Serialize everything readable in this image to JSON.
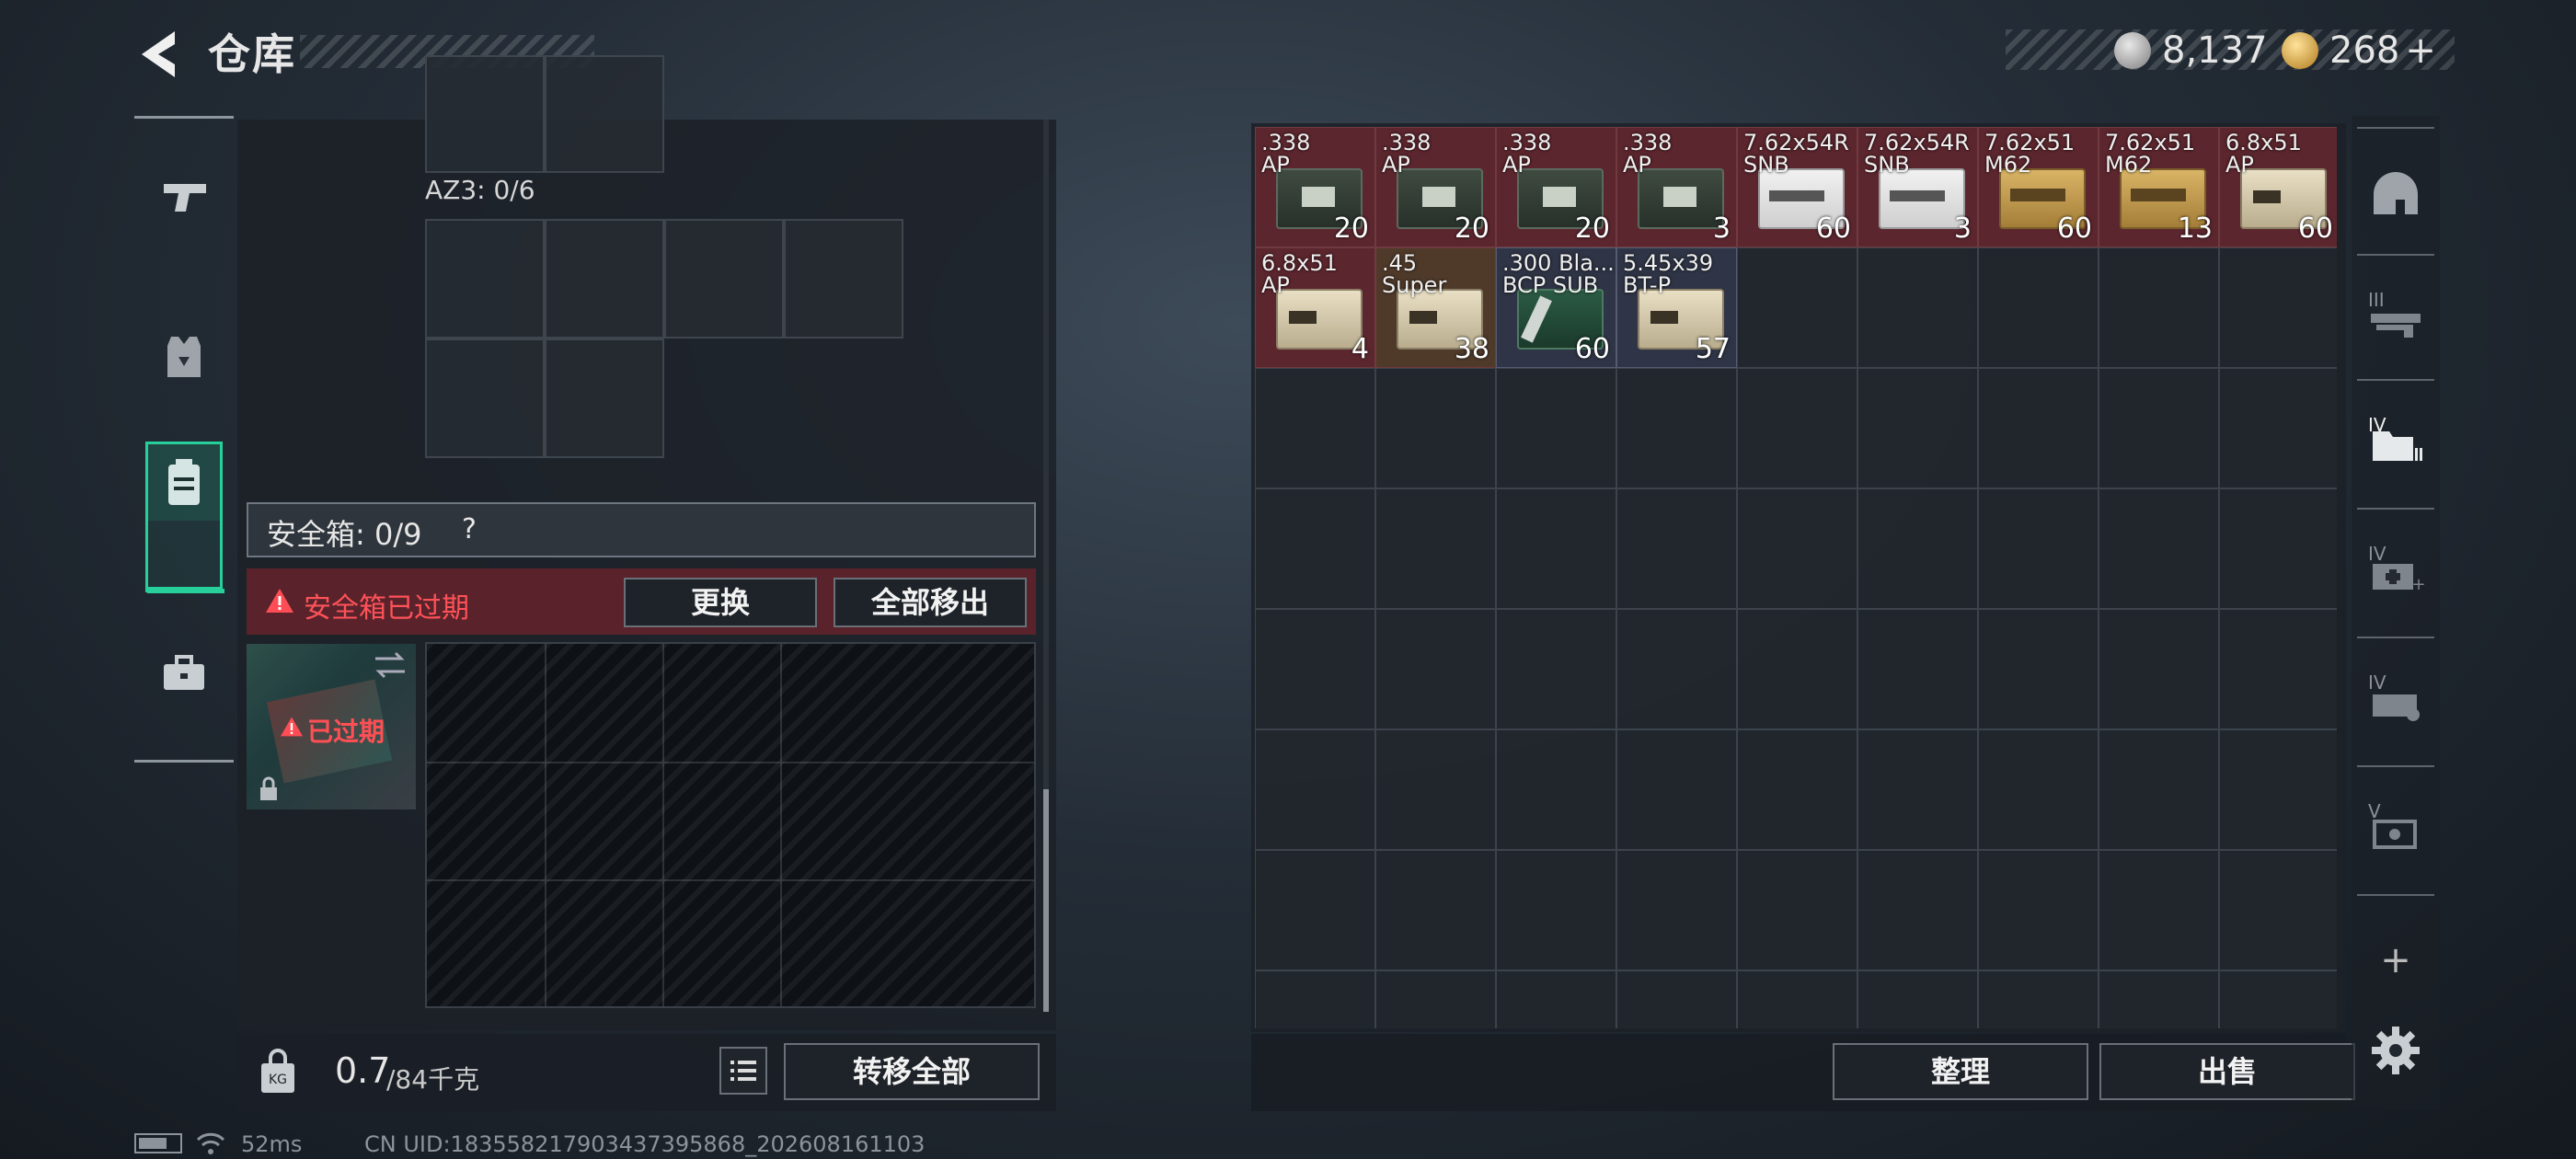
{
  "header": {
    "title": "仓库"
  },
  "currency": [
    {
      "icon": "silver-coin-icon",
      "value": "8,137"
    },
    {
      "icon": "gold-coin-icon",
      "value": "268"
    }
  ],
  "left_tabs": [
    {
      "icon": "pistol-icon"
    },
    {
      "icon": "armor-vest-icon"
    },
    {
      "icon": "backpack-icon",
      "active": true
    },
    {
      "icon": "toolbox-icon"
    }
  ],
  "loadout": {
    "az3_label": "AZ3: 0/6",
    "secure_label": "安全箱: 0/9",
    "help": "?",
    "expired_warning": "安全箱已过期",
    "replace_button": "更换",
    "move_all_out_button": "全部移出",
    "case_status": "已过期"
  },
  "weight": {
    "current": "0.7",
    "max": "/84千克"
  },
  "transfer_all_button": "转移全部",
  "stash": {
    "items": [
      {
        "name": ".338\nAP",
        "count": "20",
        "style": "red",
        "box": "dark"
      },
      {
        "name": ".338\nAP",
        "count": "20",
        "style": "red",
        "box": "dark"
      },
      {
        "name": ".338\nAP",
        "count": "20",
        "style": "red",
        "box": "dark"
      },
      {
        "name": ".338\nAP",
        "count": "3",
        "style": "red",
        "box": "dark"
      },
      {
        "name": "7.62x54R\nSNB",
        "count": "60",
        "style": "red",
        "box": "white"
      },
      {
        "name": "7.62x54R\nSNB",
        "count": "3",
        "style": "red",
        "box": "white"
      },
      {
        "name": "7.62x51\nM62",
        "count": "60",
        "style": "red",
        "box": "gold"
      },
      {
        "name": "7.62x51\nM62",
        "count": "13",
        "style": "red",
        "box": "gold"
      },
      {
        "name": "6.8x51\nAP",
        "count": "60",
        "style": "red",
        "box": "cream"
      },
      {
        "name": "6.8x51\nAP",
        "count": "4",
        "style": "red",
        "box": "cream"
      },
      {
        "name": ".45\nSuper",
        "count": "38",
        "style": "brown",
        "box": "cream"
      },
      {
        "name": ".300 Bla...\nBCP SUB",
        "count": "60",
        "style": "blue",
        "box": "green"
      },
      {
        "name": "5.45x39\nBT-P",
        "count": "57",
        "style": "blue",
        "box": "cream"
      }
    ],
    "sort_button": "整理",
    "sell_button": "出售"
  },
  "right_tabs": [
    {
      "icon": "helmet-icon",
      "label": ""
    },
    {
      "icon": "weapon-shelf-icon",
      "label": "III"
    },
    {
      "icon": "folder-cabinet-icon",
      "label": "IV"
    },
    {
      "icon": "medical-case-icon",
      "label": "IV"
    },
    {
      "icon": "tool-case-icon",
      "label": "IV"
    },
    {
      "icon": "ammo-case-icon",
      "label": "V"
    }
  ],
  "add_label": "+",
  "status": {
    "ping": "52ms",
    "uid": "CN UID:183558217903437395868_202608161103"
  },
  "colors": {
    "accent_green": "#27d09a",
    "warning_red": "#ff5258",
    "item_red": "#5c262e"
  }
}
